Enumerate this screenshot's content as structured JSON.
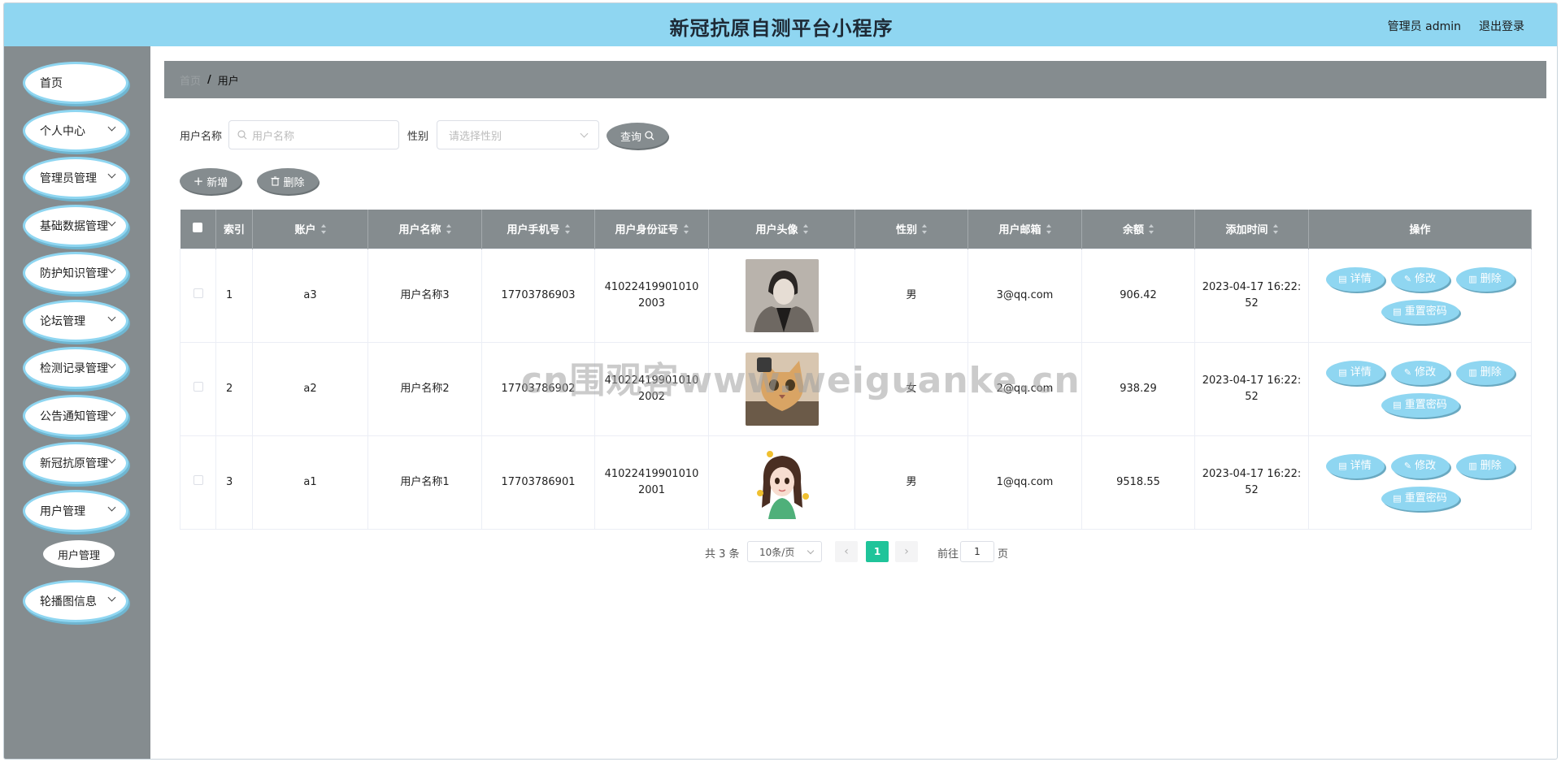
{
  "header": {
    "title": "新冠抗原自测平台小程序",
    "user": "管理员 admin",
    "logout": "退出登录"
  },
  "sidebar": {
    "items": [
      {
        "label": "首页"
      },
      {
        "label": "个人中心"
      },
      {
        "label": "管理员管理"
      },
      {
        "label": "基础数据管理"
      },
      {
        "label": "防护知识管理"
      },
      {
        "label": "论坛管理"
      },
      {
        "label": "检测记录管理"
      },
      {
        "label": "公告通知管理"
      },
      {
        "label": "新冠抗原管理"
      },
      {
        "label": "用户管理"
      },
      {
        "label": "轮播图信息"
      }
    ],
    "sub_item": "用户管理"
  },
  "breadcrumb": {
    "home": "首页",
    "sep": "/",
    "current": "用户"
  },
  "search": {
    "name_label": "用户名称",
    "name_placeholder": "用户名称",
    "gender_label": "性别",
    "gender_placeholder": "请选择性别",
    "query_btn": "查询"
  },
  "actions": {
    "add": "新增",
    "delete": "删除"
  },
  "table": {
    "headers": [
      "索引",
      "账户",
      "用户名称",
      "用户手机号",
      "用户身份证号",
      "用户头像",
      "性别",
      "用户邮箱",
      "余额",
      "添加时间",
      "操作"
    ],
    "rows": [
      {
        "index": "1",
        "account": "a3",
        "name": "用户名称3",
        "phone": "17703786903",
        "idcard": "410224199010102003",
        "gender": "男",
        "email": "3@qq.com",
        "balance": "906.42",
        "time": "2023-04-17 16:22:52"
      },
      {
        "index": "2",
        "account": "a2",
        "name": "用户名称2",
        "phone": "17703786902",
        "idcard": "410224199010102002",
        "gender": "女",
        "email": "2@qq.com",
        "balance": "938.29",
        "time": "2023-04-17 16:22:52"
      },
      {
        "index": "3",
        "account": "a1",
        "name": "用户名称1",
        "phone": "17703786901",
        "idcard": "410224199010102001",
        "gender": "男",
        "email": "1@qq.com",
        "balance": "9518.55",
        "time": "2023-04-17 16:22:52"
      }
    ],
    "ops": {
      "detail": "详情",
      "edit": "修改",
      "delete": "删除",
      "reset": "重置密码"
    }
  },
  "pagination": {
    "total": "共 3 条",
    "page_size": "10条/页",
    "current": "1",
    "goto_label": "前往",
    "goto_value": "1",
    "page_unit": "页"
  },
  "watermark": "cn围观客www.weiguanke.cn"
}
